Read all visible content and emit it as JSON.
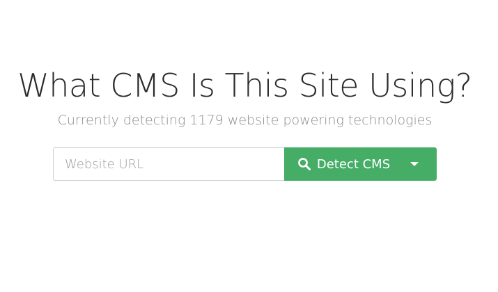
{
  "hero": {
    "title": "What CMS Is This Site Using?",
    "subtitle": "Currently detecting 1179 website powering technologies"
  },
  "search": {
    "placeholder": "Website URL",
    "value": "",
    "button_label": "Detect CMS",
    "button_icon": "search-icon",
    "dropdown_icon": "caret-down-icon"
  },
  "colors": {
    "accent": "#46ad67",
    "title": "#2b2b2b",
    "subtitle": "#8a8a8a",
    "input_border": "#cfcfcf"
  }
}
